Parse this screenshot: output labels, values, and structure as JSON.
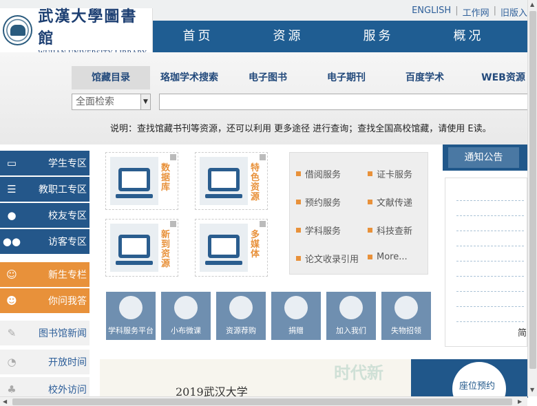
{
  "header": {
    "logo_cn": "武漢大學圖書館",
    "logo_en": "WUHAN UNIVERSITY LIBRARY",
    "top_links": [
      "ENGLISH",
      "工作网",
      "旧版入"
    ],
    "nav": [
      "首页",
      "资源",
      "服务",
      "概况"
    ]
  },
  "search": {
    "tabs": [
      "馆藏目录",
      "珞珈学术搜索",
      "电子图书",
      "电子期刊",
      "百度学术",
      "WEB资源"
    ],
    "scope": "全面检索",
    "note": "说明：查找馆藏书刊等资源，还可以利用 更多途径 进行查询；查找全国高校馆藏，请使用 E读。"
  },
  "sidebar": {
    "items": [
      {
        "label": "学生专区",
        "icon": "monitor-icon"
      },
      {
        "label": "教职工专区",
        "icon": "books-icon"
      },
      {
        "label": "校友专区",
        "icon": "user-icon"
      },
      {
        "label": "访客专区",
        "icon": "users-icon"
      },
      {
        "label": "新生专栏",
        "icon": "student-icon"
      },
      {
        "label": "你问我答",
        "icon": "monkey-icon"
      },
      {
        "label": "图书馆新闻",
        "icon": "news-icon"
      },
      {
        "label": "开放时间",
        "icon": "clock-icon"
      },
      {
        "label": "校外访问",
        "icon": "globe-icon"
      }
    ]
  },
  "resources": {
    "tiles": [
      "数据库",
      "特色资源",
      "新到资源",
      "多媒体"
    ]
  },
  "services": {
    "items": [
      "借阅服务",
      "证卡服务",
      "预约服务",
      "文献传递",
      "学科服务",
      "科技查新",
      "论文收录引用",
      "More..."
    ]
  },
  "quick_buttons": [
    "学科服务平台",
    "小布微课",
    "资源荐购",
    "捐赠",
    "加入我们",
    "失物招领"
  ],
  "notice": {
    "tab": "通知公告",
    "partial": "简"
  },
  "banner": {
    "text": "2019武汉大学",
    "big": "时代新",
    "seat": "座位预约"
  }
}
